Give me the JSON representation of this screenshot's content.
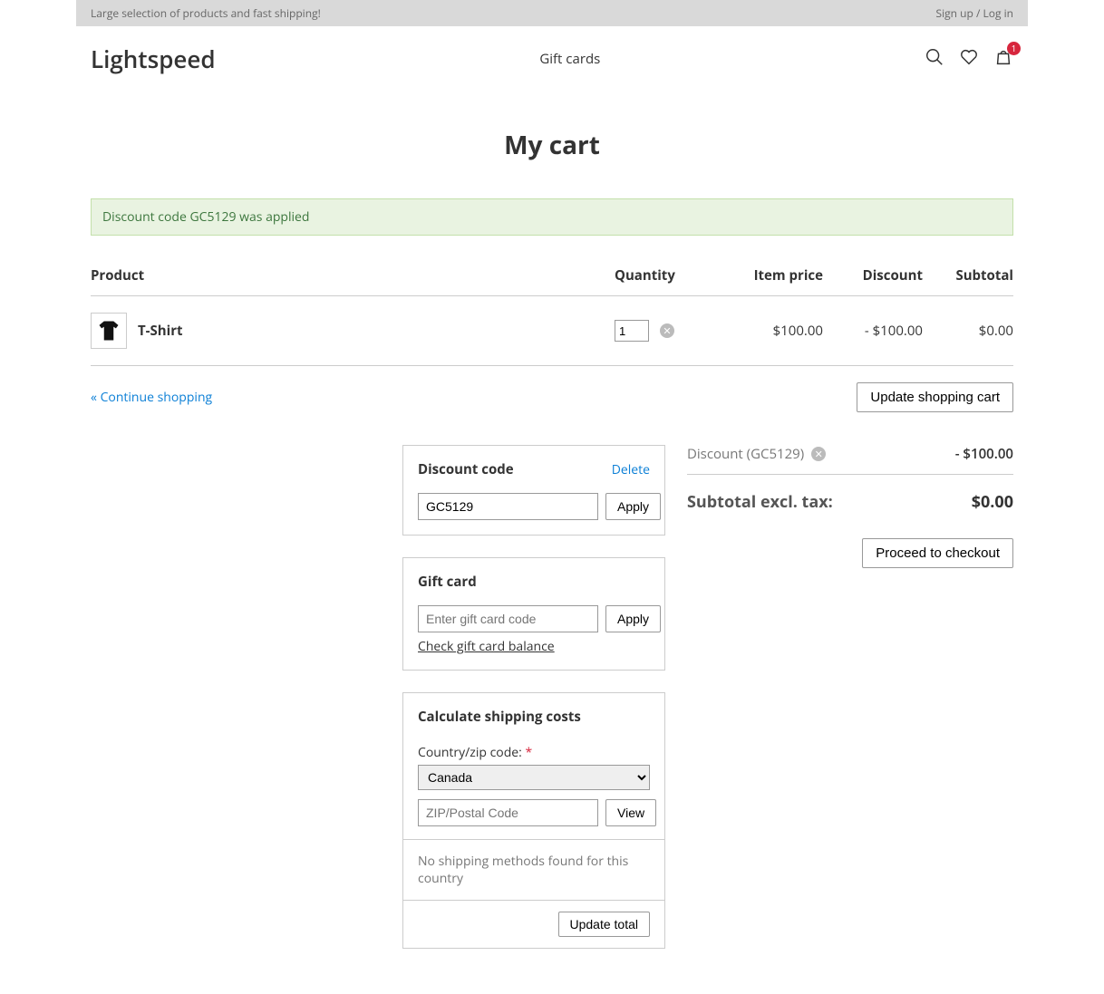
{
  "topbar": {
    "tagline": "Large selection of products and fast shipping!",
    "signup_login": "Sign up / Log in"
  },
  "header": {
    "logo": "Lightspeed",
    "nav_gift_cards": "Gift cards",
    "cart_badge": "1"
  },
  "page_title": "My cart",
  "alert_msg": "Discount code GC5129 was applied",
  "table": {
    "head_product": "Product",
    "head_quantity": "Quantity",
    "head_item_price": "Item price",
    "head_discount": "Discount",
    "head_subtotal": "Subtotal",
    "rows": [
      {
        "name": "T-Shirt",
        "qty": "1",
        "item_price": "$100.00",
        "discount": "- $100.00",
        "subtotal": "$0.00"
      }
    ]
  },
  "actions": {
    "continue_shopping": "« Continue shopping",
    "update_cart": "Update shopping cart"
  },
  "discount_panel": {
    "title": "Discount code",
    "delete": "Delete",
    "value": "GC5129",
    "apply": "Apply"
  },
  "giftcard_panel": {
    "title": "Gift card",
    "placeholder": "Enter gift card code",
    "apply": "Apply",
    "balance_link": "Check gift card balance"
  },
  "shipping_panel": {
    "title": "Calculate shipping costs",
    "country_label": "Country/zip code:",
    "country_value": "Canada",
    "zip_placeholder": "ZIP/Postal Code",
    "view": "View",
    "no_methods": "No shipping methods found for this country",
    "update_total": "Update total"
  },
  "totals": {
    "discount_label": "Discount (GC5129)",
    "discount_value": "- $100.00",
    "subtotal_label": "Subtotal excl. tax:",
    "subtotal_value": "$0.00",
    "checkout": "Proceed to checkout"
  }
}
